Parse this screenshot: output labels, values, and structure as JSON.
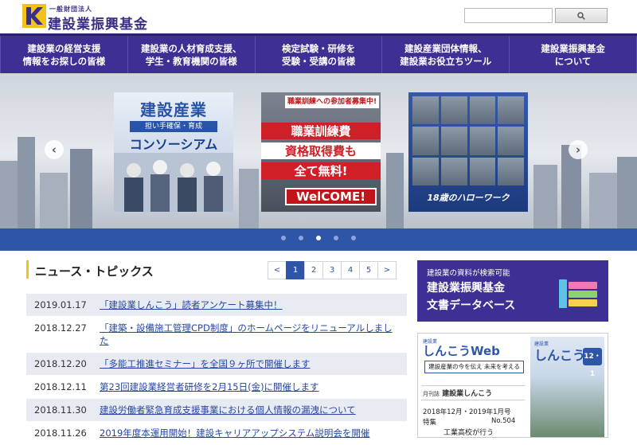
{
  "header": {
    "logo_small": "一般財団法人",
    "logo_name": "建設業振興基金",
    "search_placeholder": ""
  },
  "nav": {
    "items": [
      {
        "line1": "建設業の経営支援",
        "line2": "情報をお探しの皆様"
      },
      {
        "line1": "建設業の人材育成支援、",
        "line2": "学生・教育機関の皆様"
      },
      {
        "line1": "検定試験・研修を",
        "line2": "受験・受講の皆様"
      },
      {
        "line1": "建設産業団体情報、",
        "line2": "建設業お役立ちツール"
      },
      {
        "line1": "建設業振興基金",
        "line2": "について"
      }
    ]
  },
  "hero": {
    "banner1": {
      "title": "建設産業",
      "sub": "担い手確保・育成",
      "main": "コンソーシアム"
    },
    "banner2": {
      "top": "職業訓練への参加者募集中!",
      "l1": "職業訓練費",
      "l2": "資格取得費も",
      "l3": "全て無料!",
      "l4": "WelCOME!"
    },
    "banner3": {
      "label": "18歳のハローワーク"
    },
    "prev_arrow": "‹",
    "next_arrow": "›",
    "active_dot": 3
  },
  "news": {
    "title": "ニュース・トピックス",
    "pager": [
      "<",
      "1",
      "2",
      "3",
      "4",
      "5",
      ">"
    ],
    "active_page": "1",
    "items": [
      {
        "date": "2019.01.17",
        "text": "「建設業しんこう」読者アンケート募集中！"
      },
      {
        "date": "2018.12.27",
        "text": "「建築・設備施工管理CPD制度」のホームページをリニューアルしました"
      },
      {
        "date": "2018.12.20",
        "text": "「多能工推進セミナー」を全国９ヶ所で開催します"
      },
      {
        "date": "2018.12.11",
        "text": "第23回建設業経営者研修を2月15日(金)に開催します"
      },
      {
        "date": "2018.11.30",
        "text": "建設労働者緊急育成支援事業における個人情報の漏洩について"
      },
      {
        "date": "2018.11.26",
        "text": "2019年度本運用開始！建設キャリアアップシステム説明会を開催"
      }
    ]
  },
  "sidebar": {
    "db_banner": {
      "small": "建設業の資料が検索可能",
      "line1": "建設業振興基金",
      "line2": "文書データベース"
    },
    "magazine": {
      "web_top": "建設業",
      "web_title": "しんこうWeb",
      "desc": "建設産業の今を伝え 未来を考える",
      "name_small": "月刊誌",
      "name": "建設業しんこう",
      "issue": "2018年12月・2019年1月号",
      "tokushu": "特集",
      "no": "No.504",
      "headline": "工業高校が行う",
      "cover_top": "建設業",
      "cover_title": "しんこう",
      "cover_date": "12・1"
    }
  }
}
